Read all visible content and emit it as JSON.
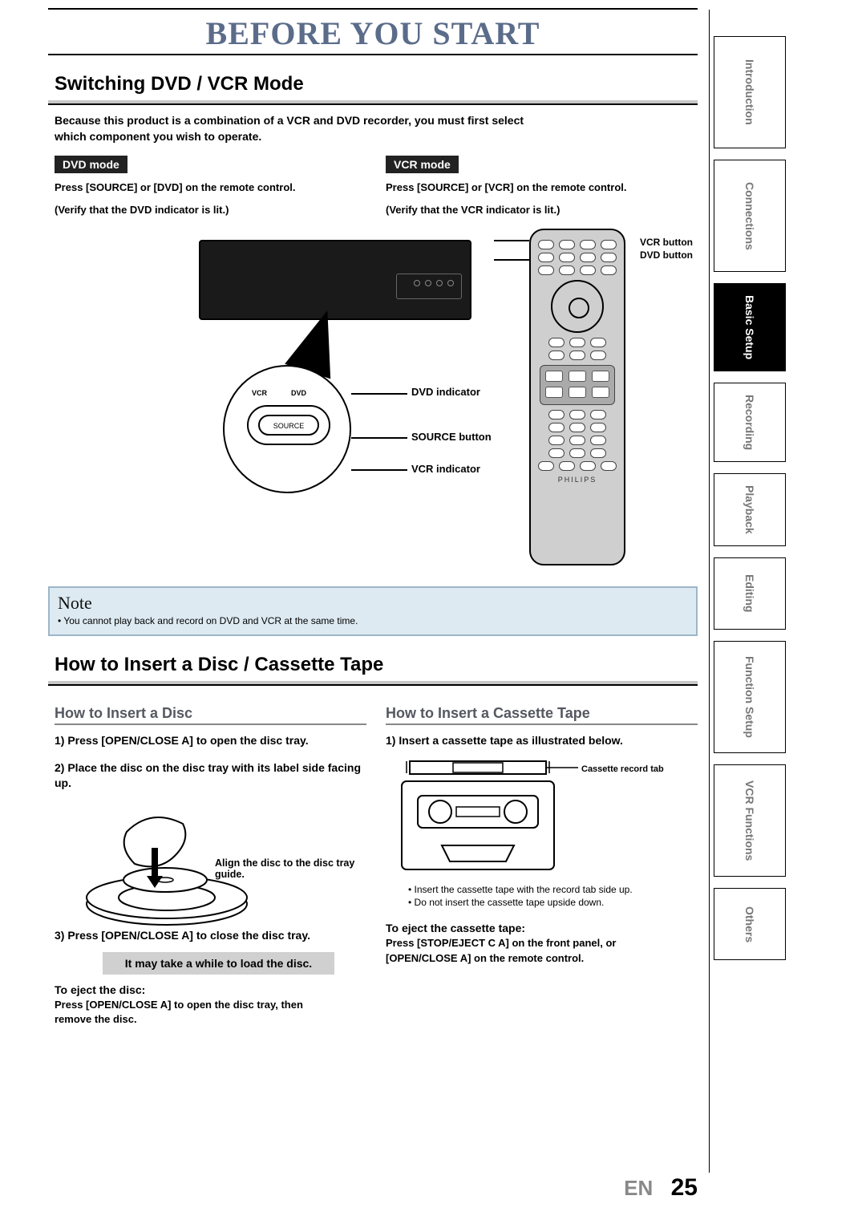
{
  "banner": "BEFORE YOU START",
  "section1": {
    "title": "Switching DVD / VCR Mode",
    "intro1": "Because this product is a combination of a VCR and DVD recorder, you must first select",
    "intro2": "which component you wish to operate.",
    "dvd": {
      "badge": "DVD mode",
      "l1": "Press [SOURCE] or [DVD] on the remote control.",
      "l2": "(Verify that the DVD indicator is lit.)"
    },
    "vcr": {
      "badge": "VCR mode",
      "l1": "Press [SOURCE] or [VCR] on the remote control.",
      "l2": "(Verify that the VCR indicator is lit.)"
    },
    "labels": {
      "dvd_ind": "DVD indicator",
      "source": "SOURCE button",
      "vcr_ind": "VCR indicator",
      "remote_vcr": "VCR button",
      "remote_dvd": "DVD button",
      "src_btn": "SOURCE",
      "c_vcr": "VCR",
      "c_dvd": "DVD"
    }
  },
  "note": {
    "title": "Note",
    "body": "• You cannot play back and record on DVD and VCR at the same time."
  },
  "section2": {
    "title": "How to Insert a Disc / Cassette Tape",
    "disc": {
      "heading": "How to Insert a Disc",
      "s1": "1) Press [OPEN/CLOSE A] to open the disc tray.",
      "s2": "2) Place the disc on the disc tray with its label side facing up.",
      "align": "Align the disc to the disc tray guide.",
      "s3": "3) Press [OPEN/CLOSE A] to close the disc tray.",
      "load": "It may take a while to load the disc.",
      "eject_h": "To eject the disc:",
      "eject_b1": "Press [OPEN/CLOSE A] to open the disc tray, then",
      "eject_b2": "remove the disc."
    },
    "cass": {
      "heading": "How to Insert a Cassette Tape",
      "s1": "1) Insert a cassette tape as illustrated below.",
      "cn1": "• Insert the cassette tape with the record tab side up.",
      "cn2": "• Do not insert the cassette tape upside down.",
      "eject_h": "To eject the cassette tape:",
      "eject_b1": "Press [STOP/EJECT C A] on the front panel, or",
      "eject_b2": "[OPEN/CLOSE A] on the remote control.",
      "tab_lbl": "Cassette record tab"
    }
  },
  "tabs": [
    "Introduction",
    "Connections",
    "Basic Setup",
    "Recording",
    "Playback",
    "Editing",
    "Function Setup",
    "VCR Functions",
    "Others"
  ],
  "active_tab": "Basic Setup",
  "footer": {
    "lang": "EN",
    "page": "25"
  },
  "remote_brand": "PHILIPS"
}
